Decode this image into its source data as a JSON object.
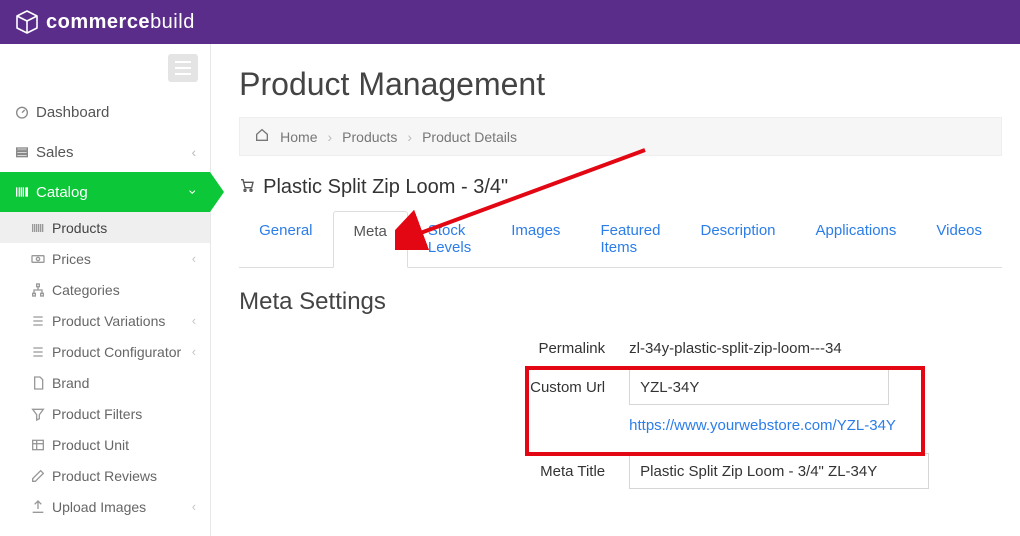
{
  "brand": {
    "name_bold": "commerce",
    "name_light": "build"
  },
  "nav": {
    "items": [
      {
        "label": "Dashboard"
      },
      {
        "label": "Sales"
      },
      {
        "label": "Catalog"
      }
    ],
    "sub": [
      {
        "label": "Products"
      },
      {
        "label": "Prices"
      },
      {
        "label": "Categories"
      },
      {
        "label": "Product Variations"
      },
      {
        "label": "Product Configurator"
      },
      {
        "label": "Brand"
      },
      {
        "label": "Product Filters"
      },
      {
        "label": "Product Unit"
      },
      {
        "label": "Product Reviews"
      },
      {
        "label": "Upload Images"
      }
    ]
  },
  "header": {
    "title": "Product Management"
  },
  "breadcrumb": {
    "home": "Home",
    "products": "Products",
    "details": "Product Details"
  },
  "product": {
    "name": "Plastic Split Zip Loom - 3/4\""
  },
  "tabs": {
    "general": "General",
    "meta": "Meta",
    "stock": "Stock Levels",
    "images": "Images",
    "featured": "Featured Items",
    "description": "Description",
    "applications": "Applications",
    "videos": "Videos"
  },
  "section": {
    "title": "Meta Settings"
  },
  "form": {
    "permalink_label": "Permalink",
    "permalink_value": "zl-34y-plastic-split-zip-loom---34",
    "custom_url_label": "Custom Url",
    "custom_url_value": "YZL-34Y",
    "custom_url_preview": "https://www.yourwebstore.com/YZL-34Y",
    "meta_title_label": "Meta Title",
    "meta_title_value": "Plastic Split Zip Loom - 3/4\" ZL-34Y"
  }
}
